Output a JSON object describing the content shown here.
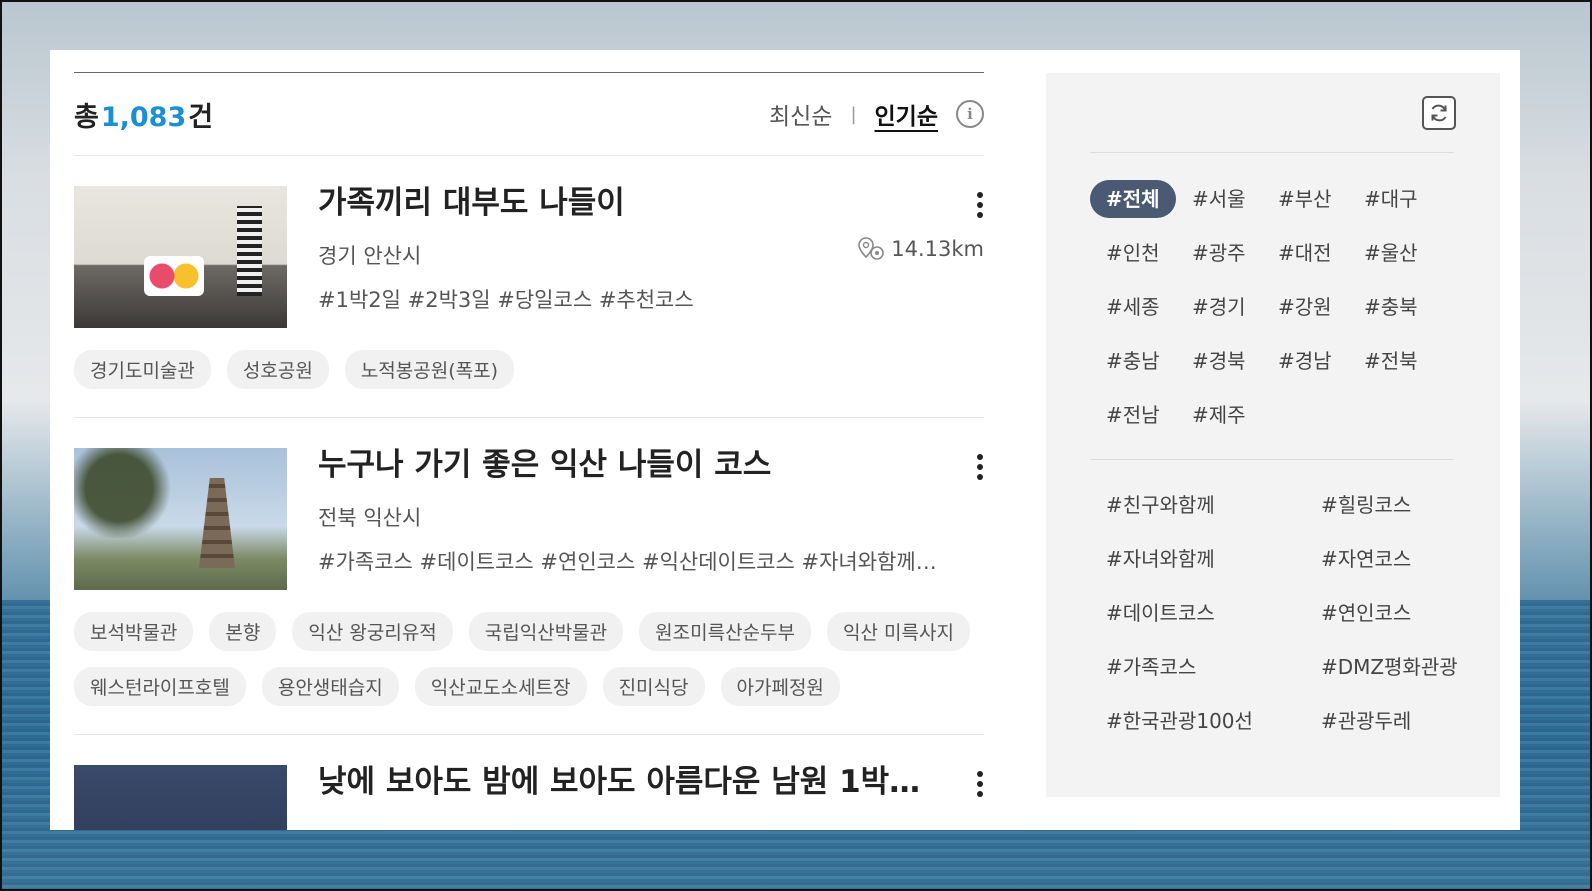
{
  "summary": {
    "total_prefix": "총",
    "total_count": "1,083",
    "total_suffix": "건",
    "sort_latest": "최신순",
    "sort_separator": "|",
    "sort_popular": "인기순"
  },
  "courses": [
    {
      "title": "가족끼리 대부도 나들이",
      "region": "경기 안산시",
      "distance": "14.13km",
      "hashtags": "#1박2일 #2박3일 #당일코스 #추천코스",
      "spots": [
        "경기도미술관",
        "성호공원",
        "노적봉공원(폭포)"
      ]
    },
    {
      "title": "누구나 가기 좋은 익산 나들이 코스",
      "region": "전북 익산시",
      "hashtags": "#가족코스 #데이트코스 #연인코스 #익산데이트코스 #자녀와함께 #…",
      "spots": [
        "보석박물관",
        "본향",
        "익산 왕궁리유적",
        "국립익산박물관",
        "원조미륵산순두부",
        "익산 미륵사지",
        "웨스턴라이프호텔",
        "용안생태습지",
        "익산교도소세트장",
        "진미식당",
        "아가페정원"
      ]
    },
    {
      "title": "낮에 보아도 밤에 보아도 아름다운 남원 1박2일 …"
    }
  ],
  "region_tags": [
    "#전체",
    "#서울",
    "#부산",
    "#대구",
    "#인천",
    "#광주",
    "#대전",
    "#울산",
    "#세종",
    "#경기",
    "#강원",
    "#충북",
    "#충남",
    "#경북",
    "#경남",
    "#전북",
    "#전남",
    "#제주"
  ],
  "theme_tags": [
    "#친구와함께",
    "#힐링코스",
    "#자녀와함께",
    "#자연코스",
    "#데이트코스",
    "#연인코스",
    "#가족코스",
    "#DMZ평화관광",
    "#한국관광100선",
    "#관광두레"
  ],
  "icons": {
    "info": "info-icon",
    "kebab": "kebab-menu-icon",
    "location": "location-pin-icon",
    "refresh": "refresh-icon"
  },
  "colors": {
    "accent_count": "#1a8fd1",
    "active_tag_bg": "#4a5a73"
  }
}
